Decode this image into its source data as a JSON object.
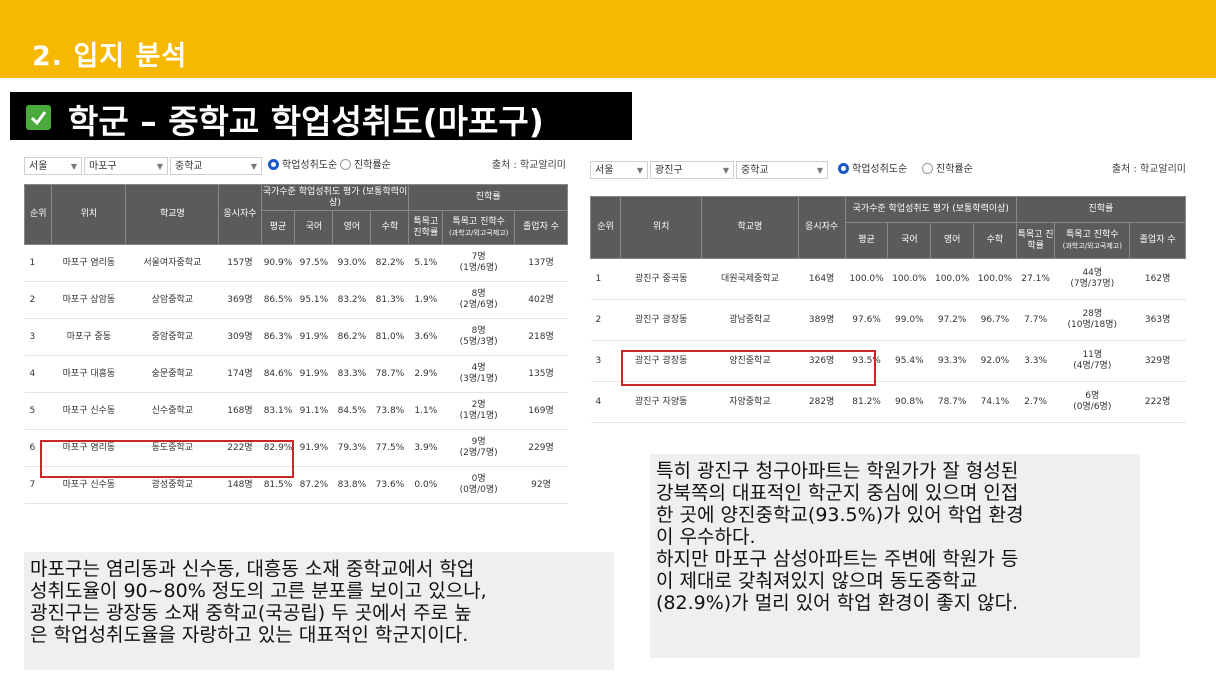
{
  "header": {
    "section_title": "2. 입지 분석"
  },
  "title": {
    "text": "학군 – 중학교 학업성취도(마포구)"
  },
  "colors": {
    "header_bg": "#f6b800",
    "title_bg": "#000000",
    "check_icon": "#4aaa3c",
    "table_header": "#5b5b5b",
    "highlight": "#c62828"
  },
  "left_panel": {
    "filters": {
      "city": "서울",
      "district": "마포구",
      "school_type": "중학교",
      "radio1": "학업성취도순",
      "radio2": "진학률순",
      "source": "출처 : 학교알리미"
    },
    "headers": {
      "rank": "순위",
      "location": "위치",
      "school": "학교명",
      "applicants": "응시자수",
      "group_achieve": "국가수준 학업성취도 평가 (보통학력이상)",
      "group_advance": "진학률",
      "avg": "평균",
      "korean": "국어",
      "english": "영어",
      "math": "수학",
      "sp_rate": "특목고 진학률",
      "sp_count": "특목고 진학수",
      "sp_sub": "(과학고/외고국제고)",
      "graduates": "졸업자 수"
    },
    "rows": [
      {
        "rank": "1",
        "location": "마포구 염리동",
        "school": "서울여자중학교",
        "applicants": "157명",
        "avg": "90.9%",
        "korean": "97.5%",
        "english": "93.0%",
        "math": "82.2%",
        "sp_rate": "5.1%",
        "sp_count": "7명",
        "sp_detail": "(1명/6명)",
        "graduates": "137명"
      },
      {
        "rank": "2",
        "location": "마포구 상암동",
        "school": "상암중학교",
        "applicants": "369명",
        "avg": "86.5%",
        "korean": "95.1%",
        "english": "83.2%",
        "math": "81.3%",
        "sp_rate": "1.9%",
        "sp_count": "8명",
        "sp_detail": "(2명/6명)",
        "graduates": "402명"
      },
      {
        "rank": "3",
        "location": "마포구 중동",
        "school": "중암중학교",
        "applicants": "309명",
        "avg": "86.3%",
        "korean": "91.9%",
        "english": "86.2%",
        "math": "81.0%",
        "sp_rate": "3.6%",
        "sp_count": "8명",
        "sp_detail": "(5명/3명)",
        "graduates": "218명"
      },
      {
        "rank": "4",
        "location": "마포구 대흥동",
        "school": "숭문중학교",
        "applicants": "174명",
        "avg": "84.6%",
        "korean": "91.9%",
        "english": "83.3%",
        "math": "78.7%",
        "sp_rate": "2.9%",
        "sp_count": "4명",
        "sp_detail": "(3명/1명)",
        "graduates": "135명"
      },
      {
        "rank": "5",
        "location": "마포구 신수동",
        "school": "신수중학교",
        "applicants": "168명",
        "avg": "83.1%",
        "korean": "91.1%",
        "english": "84.5%",
        "math": "73.8%",
        "sp_rate": "1.1%",
        "sp_count": "2명",
        "sp_detail": "(1명/1명)",
        "graduates": "169명"
      },
      {
        "rank": "6",
        "location": "마포구 염리동",
        "school": "동도중학교",
        "applicants": "222명",
        "avg": "82.9%",
        "korean": "91.9%",
        "english": "79.3%",
        "math": "77.5%",
        "sp_rate": "3.9%",
        "sp_count": "9명",
        "sp_detail": "(2명/7명)",
        "graduates": "229명"
      },
      {
        "rank": "7",
        "location": "마포구 신수동",
        "school": "광성중학교",
        "applicants": "148명",
        "avg": "81.5%",
        "korean": "87.2%",
        "english": "83.8%",
        "math": "73.6%",
        "sp_rate": "0.0%",
        "sp_count": "0명",
        "sp_detail": "(0명/0명)",
        "graduates": "92명"
      }
    ]
  },
  "right_panel": {
    "filters": {
      "city": "서울",
      "district": "광진구",
      "school_type": "중학교",
      "radio1": "학업성취도순",
      "radio2": "진학률순",
      "source": "출처 : 학교알리미"
    },
    "rows": [
      {
        "rank": "1",
        "location": "광진구 중곡동",
        "school": "대원국제중학교",
        "applicants": "164명",
        "avg": "100.0%",
        "korean": "100.0%",
        "english": "100.0%",
        "math": "100.0%",
        "sp_rate": "27.1%",
        "sp_count": "44명",
        "sp_detail": "(7명/37명)",
        "graduates": "162명"
      },
      {
        "rank": "2",
        "location": "광진구 광장동",
        "school": "광남중학교",
        "applicants": "389명",
        "avg": "97.6%",
        "korean": "99.0%",
        "english": "97.2%",
        "math": "96.7%",
        "sp_rate": "7.7%",
        "sp_count": "28명",
        "sp_detail": "(10명/18명)",
        "graduates": "363명"
      },
      {
        "rank": "3",
        "location": "광진구 광장동",
        "school": "양진중학교",
        "applicants": "326명",
        "avg": "93.5%",
        "korean": "95.4%",
        "english": "93.3%",
        "math": "92.0%",
        "sp_rate": "3.3%",
        "sp_count": "11명",
        "sp_detail": "(4명/7명)",
        "graduates": "329명"
      },
      {
        "rank": "4",
        "location": "광진구 자양동",
        "school": "자양중학교",
        "applicants": "282명",
        "avg": "81.2%",
        "korean": "90.8%",
        "english": "78.7%",
        "math": "74.1%",
        "sp_rate": "2.7%",
        "sp_count": "6명",
        "sp_detail": "(0명/6명)",
        "graduates": "222명"
      }
    ]
  },
  "notes": {
    "left": "마포구는 염리동과 신수동, 대흥동 소재 중학교에서 학업\n성취도율이 90~80% 정도의 고른 분포를 보이고 있으나,\n광진구는 광장동 소재 중학교(국공립) 두 곳에서 주로 높\n은 학업성취도율을 자랑하고 있는 대표적인 학군지이다.",
    "right": "특히 광진구 청구아파트는 학원가가 잘 형성된\n강북쪽의 대표적인 학군지 중심에 있으며 인접\n한 곳에 양진중학교(93.5%)가 있어 학업 환경\n이 우수하다.\n하지만 마포구 삼성아파트는 주변에 학원가 등\n이 제대로 갖춰져있지 않으며 동도중학교\n(82.9%)가 멀리 있어 학업 환경이 좋지 않다."
  }
}
